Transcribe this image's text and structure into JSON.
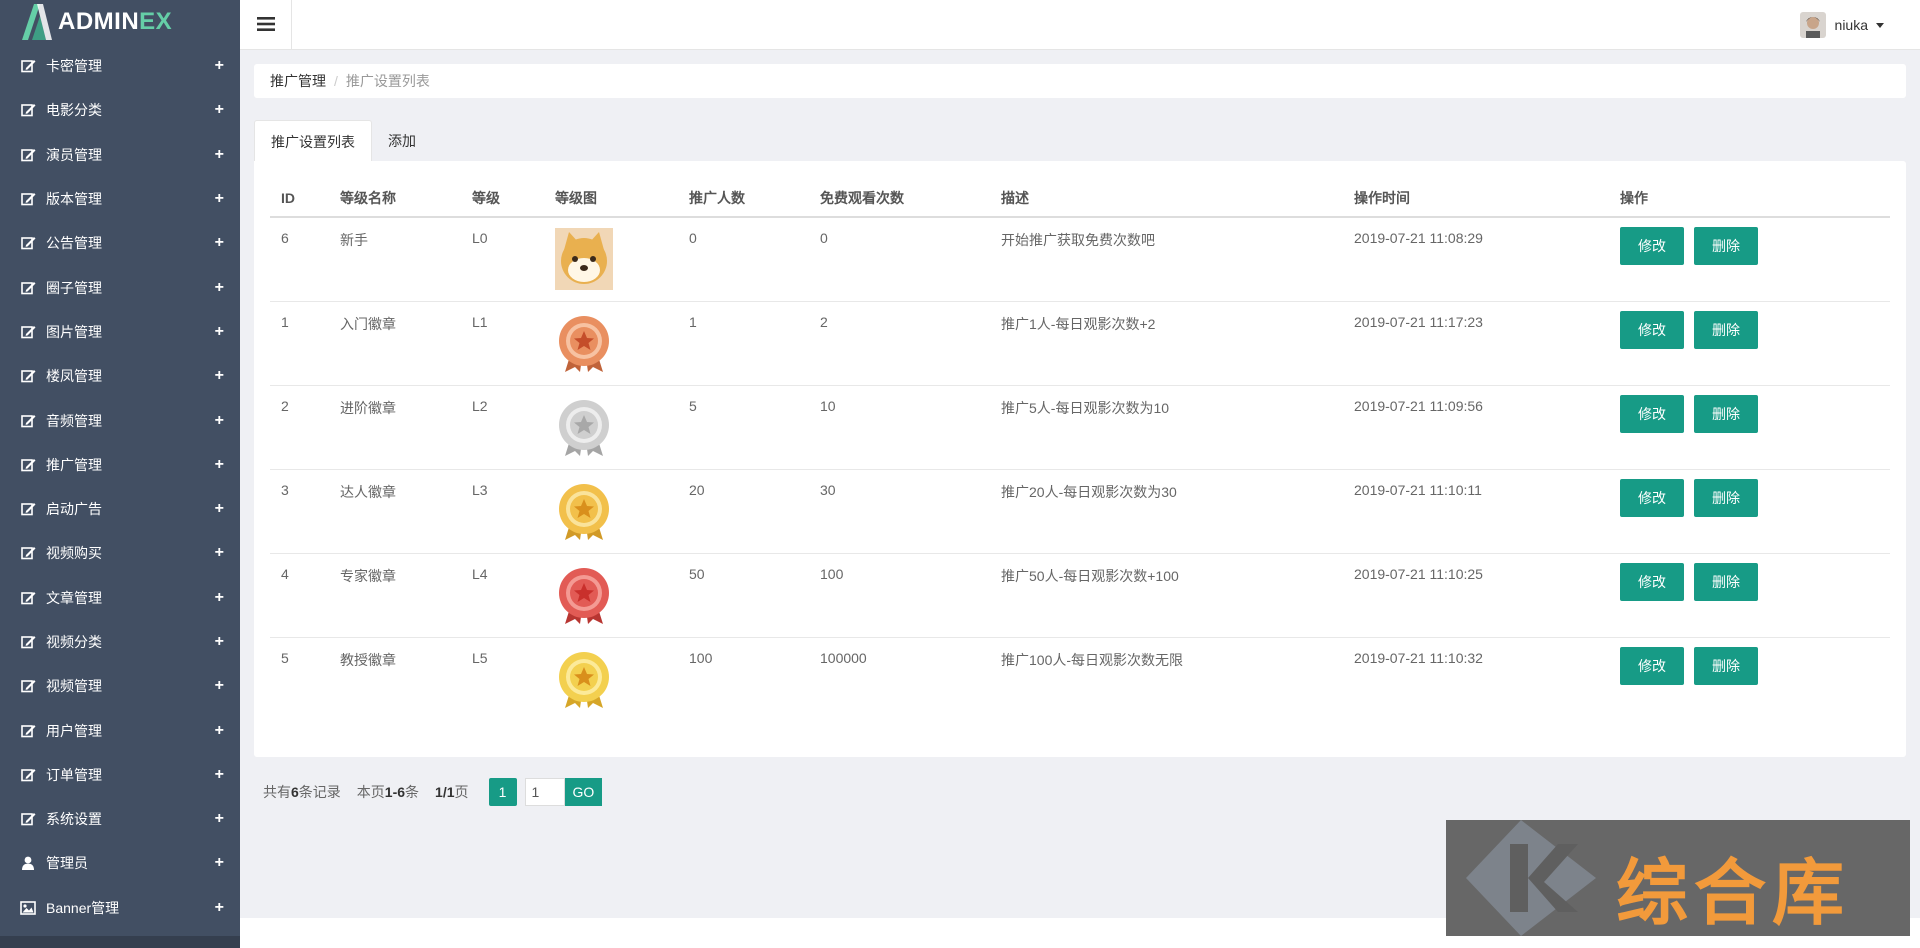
{
  "app": {
    "logo_prefix": "ADMIN",
    "logo_suffix": "EX"
  },
  "sidebar": {
    "items": [
      {
        "label": "卡密管理",
        "icon": "edit-icon"
      },
      {
        "label": "电影分类",
        "icon": "edit-icon"
      },
      {
        "label": "演员管理",
        "icon": "edit-icon"
      },
      {
        "label": "版本管理",
        "icon": "edit-icon"
      },
      {
        "label": "公告管理",
        "icon": "edit-icon"
      },
      {
        "label": "圈子管理",
        "icon": "edit-icon"
      },
      {
        "label": "图片管理",
        "icon": "edit-icon"
      },
      {
        "label": "楼凤管理",
        "icon": "edit-icon"
      },
      {
        "label": "音频管理",
        "icon": "edit-icon"
      },
      {
        "label": "推广管理",
        "icon": "edit-icon"
      },
      {
        "label": "启动广告",
        "icon": "edit-icon"
      },
      {
        "label": "视频购买",
        "icon": "edit-icon"
      },
      {
        "label": "文章管理",
        "icon": "edit-icon"
      },
      {
        "label": "视频分类",
        "icon": "edit-icon"
      },
      {
        "label": "视频管理",
        "icon": "edit-icon"
      },
      {
        "label": "用户管理",
        "icon": "edit-icon"
      },
      {
        "label": "订单管理",
        "icon": "edit-icon"
      },
      {
        "label": "系统设置",
        "icon": "edit-icon"
      },
      {
        "label": "管理员",
        "icon": "user-icon"
      },
      {
        "label": "Banner管理",
        "icon": "image-icon"
      }
    ],
    "expand_symbol": "+"
  },
  "header": {
    "username": "niuka"
  },
  "breadcrumb": {
    "parent": "推广管理",
    "separator": "/",
    "current": "推广设置列表"
  },
  "tabs": [
    {
      "label": "推广设置列表",
      "active": true
    },
    {
      "label": "添加",
      "active": false
    }
  ],
  "table": {
    "columns": [
      "ID",
      "等级名称",
      "等级",
      "等级图",
      "推广人数",
      "免费观看次数",
      "描述",
      "操作时间",
      "操作"
    ],
    "rows": [
      {
        "id": "6",
        "name": "新手",
        "level": "L0",
        "image": "doge-icon",
        "count": "0",
        "free": "0",
        "desc": "开始推广获取免费次数吧",
        "time": "2019-07-21 11:08:29"
      },
      {
        "id": "1",
        "name": "入门徽章",
        "level": "L1",
        "image": "bronze-medal-icon",
        "count": "1",
        "free": "2",
        "desc": "推广1人-每日观影次数+2",
        "time": "2019-07-21 11:17:23"
      },
      {
        "id": "2",
        "name": "进阶徽章",
        "level": "L2",
        "image": "silver-medal-icon",
        "count": "5",
        "free": "10",
        "desc": "推广5人-每日观影次数为10",
        "time": "2019-07-21 11:09:56"
      },
      {
        "id": "3",
        "name": "达人徽章",
        "level": "L3",
        "image": "gold-medal-icon",
        "count": "20",
        "free": "30",
        "desc": "推广20人-每日观影次数为30",
        "time": "2019-07-21 11:10:11"
      },
      {
        "id": "4",
        "name": "专家徽章",
        "level": "L4",
        "image": "red-medal-icon",
        "count": "50",
        "free": "100",
        "desc": "推广50人-每日观影次数+100",
        "time": "2019-07-21 11:10:25"
      },
      {
        "id": "5",
        "name": "教授徽章",
        "level": "L5",
        "image": "yellow-medal-icon",
        "count": "100",
        "free": "100000",
        "desc": "推广100人-每日观影次数无限",
        "time": "2019-07-21 11:10:32"
      }
    ],
    "edit_label": "修改",
    "delete_label": "删除"
  },
  "pagination": {
    "total_prefix": "共有",
    "total": "6",
    "total_suffix": "条记录",
    "page_prefix": "本页",
    "page_range": "1-6",
    "page_suffix": "条",
    "pages": "1/1",
    "pages_suffix": "页",
    "current": "1",
    "input_value": "1",
    "go_label": "GO"
  },
  "watermark": {
    "text": "综合库"
  },
  "colors": {
    "sidebar": "#424f63",
    "accent": "#179b86",
    "logo_accent": "#65cea7",
    "watermark_text": "#f29a3b"
  }
}
